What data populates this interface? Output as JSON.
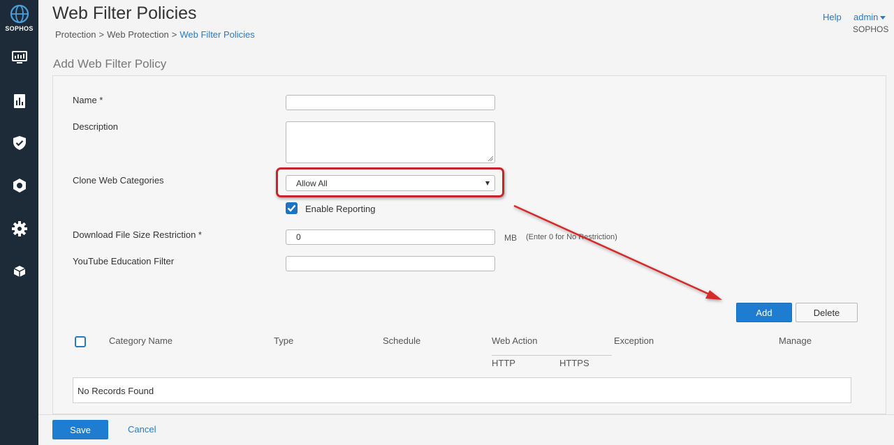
{
  "app": {
    "logo_text": "SOPHOS"
  },
  "header": {
    "title": "Web Filter Policies",
    "breadcrumb": [
      "Protection",
      "Web Protection",
      "Web Filter Policies"
    ],
    "help": "Help",
    "user": "admin",
    "org": "SOPHOS"
  },
  "sidebar": {
    "items": [
      {
        "icon": "monitor-icon"
      },
      {
        "icon": "report-icon"
      },
      {
        "icon": "shield-check-icon"
      },
      {
        "icon": "protection-icon"
      },
      {
        "icon": "gear-icon"
      },
      {
        "icon": "box-icon"
      }
    ]
  },
  "form": {
    "section_title": "Add Web Filter Policy",
    "name_label": "Name *",
    "name_value": "",
    "description_label": "Description",
    "clone_label": "Clone Web Categories",
    "clone_value": "Allow All",
    "enable_reporting_label": "Enable Reporting",
    "enable_reporting_checked": true,
    "download_label": "Download File Size Restriction *",
    "download_value": "0",
    "download_unit": "MB",
    "download_hint": "(Enter 0 for No Restriction)",
    "youtube_label": "YouTube Education Filter",
    "youtube_value": ""
  },
  "table": {
    "add_label": "Add",
    "delete_label": "Delete",
    "columns": {
      "category_name": "Category Name",
      "type": "Type",
      "schedule": "Schedule",
      "web_action": "Web Action",
      "exception": "Exception",
      "manage": "Manage"
    },
    "sub_columns": {
      "http": "HTTP",
      "https": "HTTPS"
    },
    "empty_message": "No Records Found"
  },
  "footer": {
    "save_label": "Save",
    "cancel_label": "Cancel"
  },
  "colors": {
    "sidebar": "#1d2b38",
    "accent": "#1e7dd0",
    "link": "#2a7abf",
    "highlight": "#c8252b"
  }
}
